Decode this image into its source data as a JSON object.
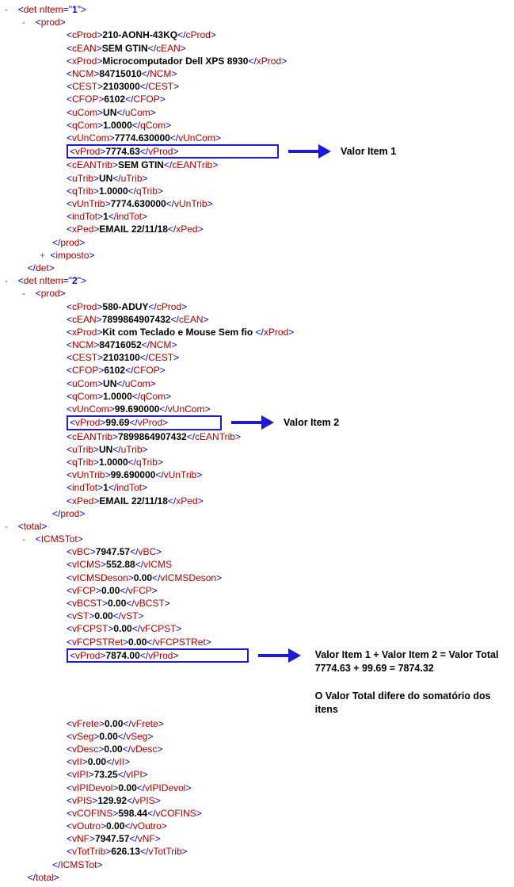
{
  "det1": {
    "openAttrName": "nItem",
    "openAttrVal": "1",
    "prod": {
      "cProd": "210-AONH-43KQ",
      "cEAN": "SEM GTIN",
      "xProd": "Microcomputador Dell XPS 8930",
      "NCM": "84715010",
      "CEST": "2103000",
      "CFOP": "6102",
      "uCom": "UN",
      "qCom": "1.0000",
      "vUnCom": "7774.630000",
      "vProd": "7774.63",
      "cEANTrib": "SEM GTIN",
      "uTrib": "UN",
      "qTrib": "1.0000",
      "vUnTrib": "7774.630000",
      "indTot": "1",
      "xPed": "EMAIL 22/11/18"
    },
    "annotation": "Valor Item 1"
  },
  "det2": {
    "openAttrName": "nItem",
    "openAttrVal": "2",
    "prod": {
      "cProd": "580-ADUY",
      "cEAN": "7899864907432",
      "xProd": "Kit com Teclado e Mouse Sem fio ",
      "NCM": "84716052",
      "CEST": "2103100",
      "CFOP": "6102",
      "uCom": "UN",
      "qCom": "1.0000",
      "vUnCom": "99.690000",
      "vProd": "99.69",
      "cEANTrib": "7899864907432",
      "uTrib": "UN",
      "qTrib": "1.0000",
      "vUnTrib": "99.690000",
      "indTot": "1",
      "xPed": "EMAIL 22/11/18"
    },
    "annotation": "Valor Item 2"
  },
  "total": {
    "ICMSTot": {
      "vBC": "7947.57",
      "vICMS": "552.88",
      "vICMSDeson": "0.00",
      "vFCP": "0.00",
      "vBCST": "0.00",
      "vST": "0.00",
      "vFCPST": "0.00",
      "vFCPSTRet": "0.00",
      "vProd": "7874.00",
      "vFrete": "0.00",
      "vSeg": "0.00",
      "vDesc": "0.00",
      "vII": "0.00",
      "vIPI": "73.25",
      "vIPIDevol": "0.00",
      "vPIS": "129.92",
      "vCOFINS": "598.44",
      "vOutro": "0.00",
      "vNF": "7947.57",
      "vTotTrib": "626.13"
    },
    "annotation_line1": "Valor Item 1 + Valor Item 2 = Valor Total",
    "annotation_line2": "7774.63 + 99.69 = 7874.32",
    "annotation_line3": "O Valor Total difere do somatório dos itens"
  }
}
